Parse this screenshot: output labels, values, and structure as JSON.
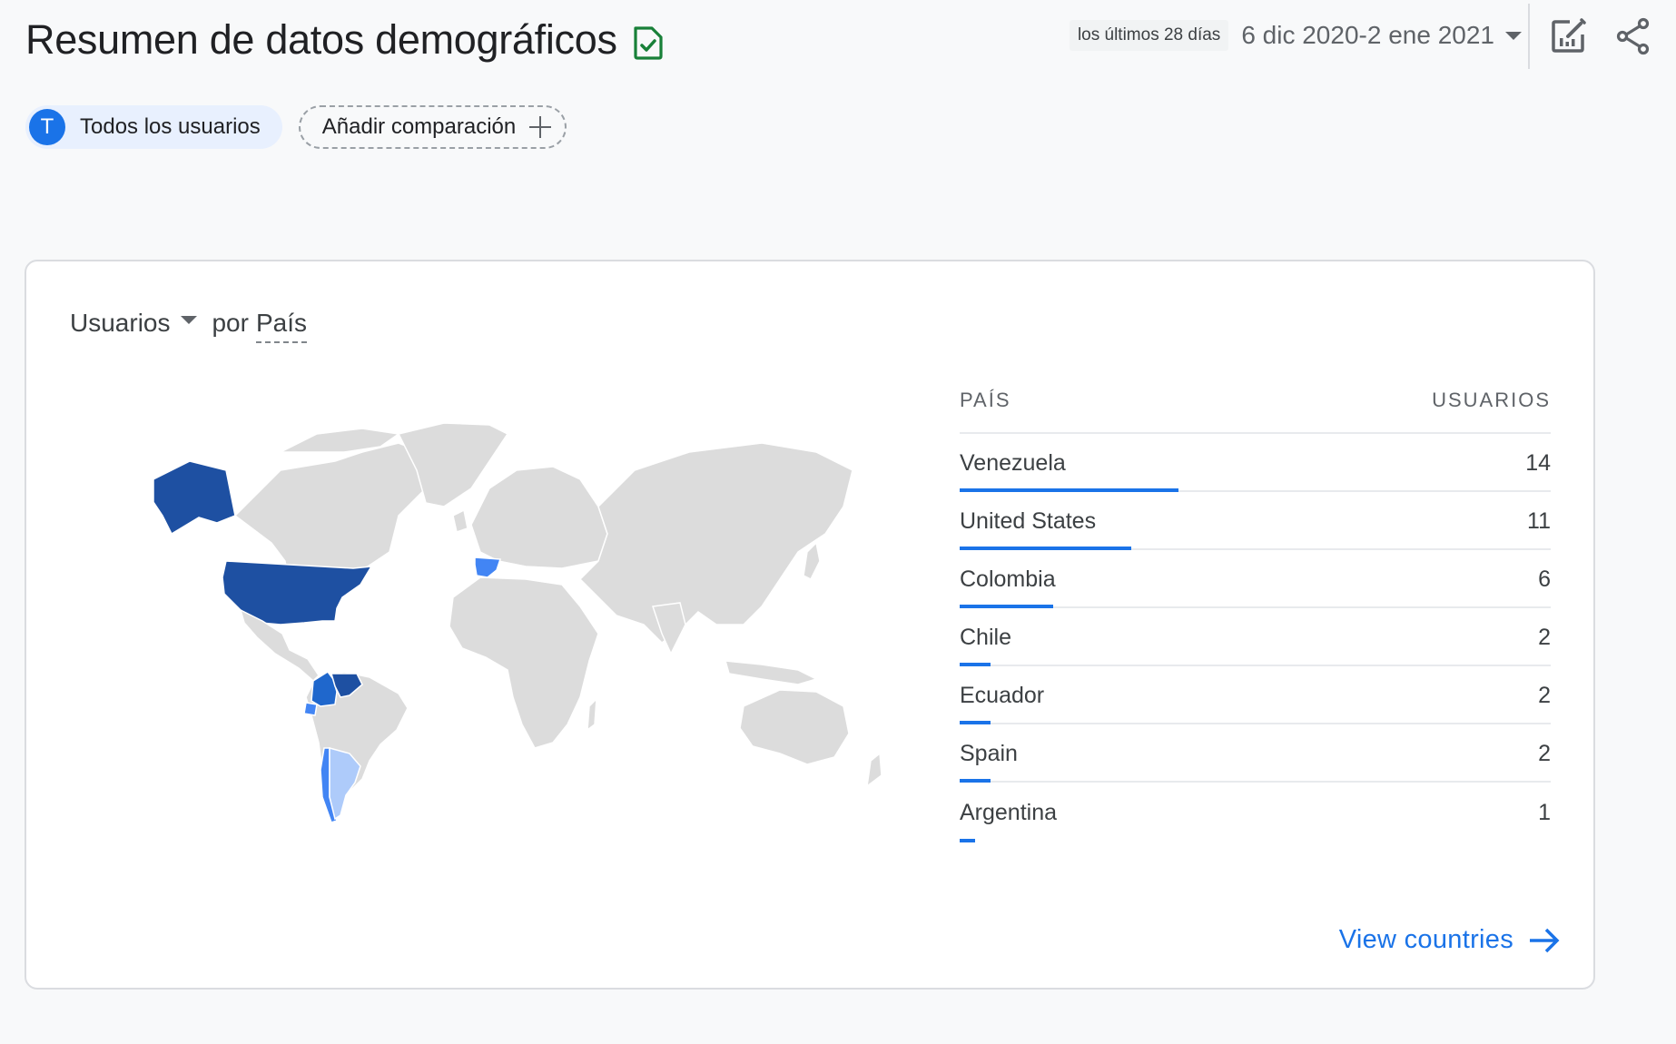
{
  "header": {
    "title": "Resumen de datos demográficos",
    "title_icon": "report-check-icon",
    "date_badge": "los últimos 28 días",
    "date_range": "6 dic 2020-2 ene 2021",
    "actions": [
      {
        "icon": "edit-report-icon"
      },
      {
        "icon": "share-icon"
      }
    ]
  },
  "comparisons": {
    "active": {
      "avatar_letter": "T",
      "label": "Todos los usuarios"
    },
    "add_label": "Añadir comparación"
  },
  "card": {
    "metric": "Usuarios",
    "dimension_prefix": "por",
    "dimension": "País",
    "table": {
      "headers": {
        "country": "PAÍS",
        "users": "USUARIOS"
      },
      "rows": [
        {
          "country": "Venezuela",
          "users": "14",
          "value": 14
        },
        {
          "country": "United States",
          "users": "11",
          "value": 11
        },
        {
          "country": "Colombia",
          "users": "6",
          "value": 6
        },
        {
          "country": "Chile",
          "users": "2",
          "value": 2
        },
        {
          "country": "Ecuador",
          "users": "2",
          "value": 2
        },
        {
          "country": "Spain",
          "users": "2",
          "value": 2
        },
        {
          "country": "Argentina",
          "users": "1",
          "value": 1
        }
      ],
      "bar_max_fraction_of_width": 0.37
    },
    "view_link": "View countries",
    "map_colors": {
      "Venezuela": "#1e50a2",
      "United States": "#1e50a2",
      "Colombia": "#1f67cc",
      "Chile": "#4285f4",
      "Ecuador": "#4285f4",
      "Spain": "#4285f4",
      "Argentina": "#aecbfa",
      "default": "#dcdcdc"
    }
  },
  "colors": {
    "accent": "#1a73e8",
    "success": "#188038",
    "text": "#202124",
    "muted": "#5f6368"
  }
}
